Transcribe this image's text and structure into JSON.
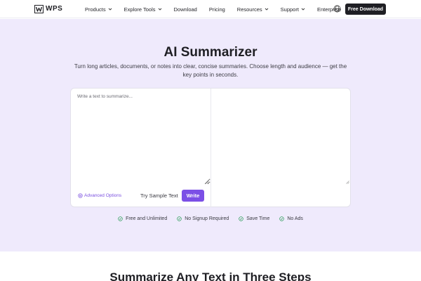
{
  "header": {
    "logo_text": "WPS",
    "nav": [
      {
        "label": "Products",
        "dropdown": true
      },
      {
        "label": "Explore Tools",
        "dropdown": true
      },
      {
        "label": "Download",
        "dropdown": false
      },
      {
        "label": "Pricing",
        "dropdown": false
      },
      {
        "label": "Resources",
        "dropdown": true
      },
      {
        "label": "Support",
        "dropdown": true
      },
      {
        "label": "Enterprise",
        "dropdown": false
      }
    ],
    "language_icon": "globe-icon",
    "cta_label": "Free Download"
  },
  "hero": {
    "title": "AI Summarizer",
    "subtitle": "Turn long articles, documents, or notes into clear, concise summaries. Choose length and audience — get the key points in seconds."
  },
  "editor": {
    "input_placeholder": "Write a text to summarize...",
    "input_value": "",
    "advanced_label": "Advanced Options",
    "sample_label": "Try Sample Text",
    "write_label": "Write"
  },
  "features": [
    {
      "label": "Free and Unlimited",
      "icon": "check-circle-icon"
    },
    {
      "label": "No Signup Required",
      "icon": "check-circle-icon"
    },
    {
      "label": "Save Time",
      "icon": "check-circle-icon"
    },
    {
      "label": "No Ads",
      "icon": "check-circle-icon"
    }
  ],
  "steps_section": {
    "title": "Summarize Any Text in Three Steps"
  },
  "colors": {
    "accent": "#7b4fe6",
    "hero_bg": "#efeafc",
    "dark_button": "#1f1f24",
    "check": "#2e9e5b"
  }
}
